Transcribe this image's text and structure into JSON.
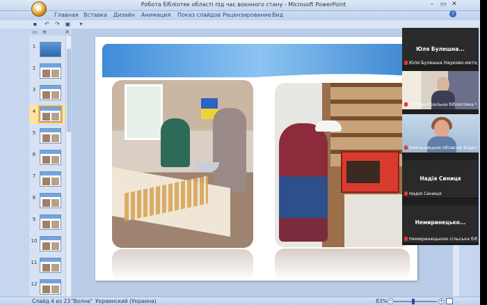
{
  "window": {
    "title": "Робота бібліотек області під час воєнного стану - Microsoft PowerPoint"
  },
  "ribbon": {
    "tabs": [
      "Главная",
      "Вставка",
      "Дизайн",
      "Анимация",
      "Показ слайдов",
      "Рецензирование",
      "Вид"
    ]
  },
  "slides_panel": {
    "slide_numbers": [
      "1",
      "2",
      "3",
      "4",
      "5",
      "6",
      "7",
      "8",
      "9",
      "10",
      "11",
      "12"
    ],
    "active_slide": "4"
  },
  "participants": [
    {
      "name": "Юля Булешна...",
      "caption": "Юля Булешна Науково-методи..."
    },
    {
      "name": "",
      "caption": "КЗ \"Центральна бібліотека ЧСК\""
    },
    {
      "name": "",
      "caption": "Хмельницьке обласне відділен..."
    },
    {
      "name": "Надія Синиця",
      "caption": "Надія Синиця"
    },
    {
      "name": "Немиринецько...",
      "caption": "Немиринецькою сільська бібл..."
    }
  ],
  "status_bar": {
    "slide_info": "Слайд 4 из 23",
    "theme": "\"Волна\"",
    "language": "Украинский (Украина)",
    "zoom": "83%"
  }
}
